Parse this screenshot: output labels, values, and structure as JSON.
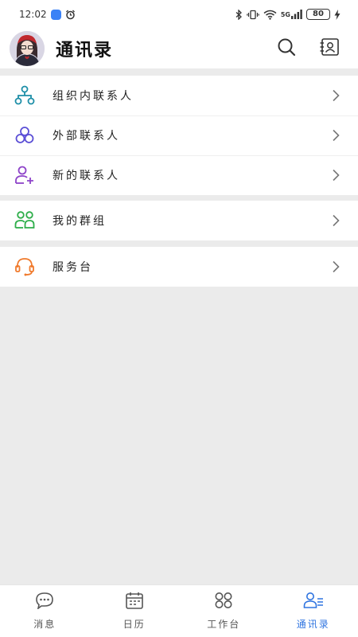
{
  "status_bar": {
    "time": "12:02",
    "network": "5G",
    "battery": "80"
  },
  "header": {
    "title": "通讯录"
  },
  "sections": {
    "contacts": [
      {
        "label": "组织内联系人",
        "icon": "org-tree-icon"
      },
      {
        "label": "外部联系人",
        "icon": "external-contacts-icon"
      },
      {
        "label": "新的联系人",
        "icon": "add-user-icon"
      }
    ],
    "groups": [
      {
        "label": "我的群组",
        "icon": "group-icon"
      }
    ],
    "service": [
      {
        "label": "服务台",
        "icon": "headset-icon"
      }
    ]
  },
  "tabbar": {
    "tabs": [
      {
        "label": "消息",
        "icon": "message-icon",
        "active": false
      },
      {
        "label": "日历",
        "icon": "calendar-icon",
        "active": false
      },
      {
        "label": "工作台",
        "icon": "workbench-icon",
        "active": false
      },
      {
        "label": "通讯录",
        "icon": "contacts-icon",
        "active": true
      }
    ]
  },
  "colors": {
    "accent": "#2f74e0",
    "org_icon": "#1e8fa8",
    "external_icon": "#5b4fd6",
    "new_contact_icon": "#8e44c9",
    "group_icon": "#2eae4a",
    "service_icon": "#f07a2c",
    "background": "#ebebeb"
  }
}
